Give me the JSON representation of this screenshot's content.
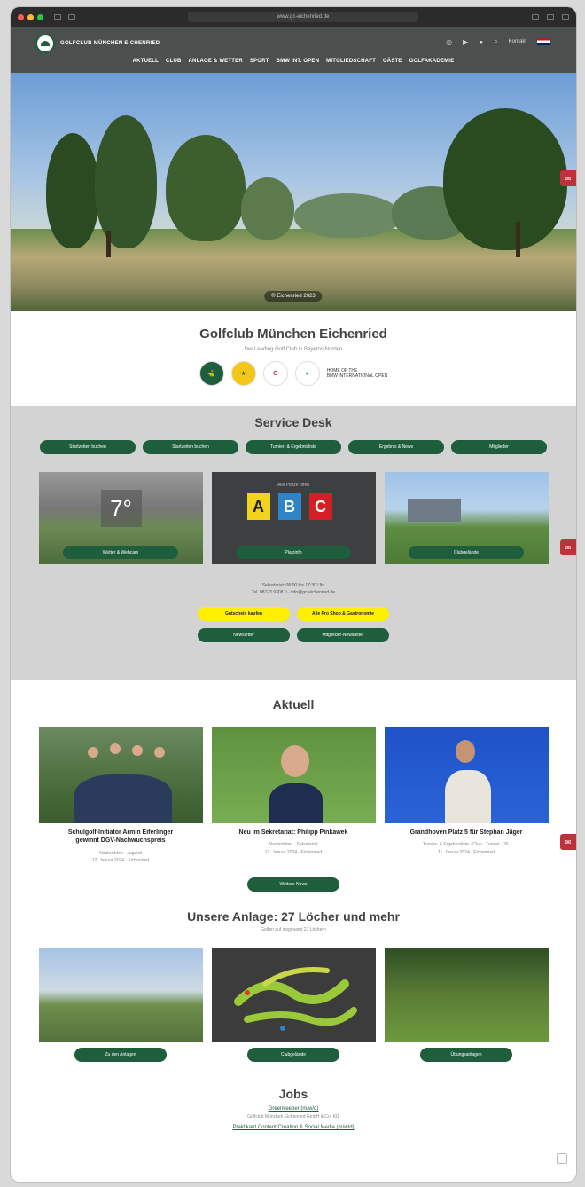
{
  "browser": {
    "url": "www.gc-eichenried.de"
  },
  "header": {
    "logo_text": "GOLFCLUB MÜNCHEN EICHENRIED",
    "kontakt": "Kontakt",
    "nav": [
      "AKTUELL",
      "CLUB",
      "ANLAGE & WETTER",
      "SPORT",
      "BMW INT. OPEN",
      "MITGLIEDSCHAFT",
      "GÄSTE",
      "GOLFAKADEMIE"
    ]
  },
  "hero": {
    "caption": "© Eichenried 2023"
  },
  "intro": {
    "title": "Golfclub München Eichenried",
    "subtitle": "Der Leading Golf Club in Bayerns Norden",
    "partner_icons": [
      "club-crest-icon",
      "leading-golf-clubs-icon",
      "callaway-icon",
      "bmw-icon"
    ],
    "bmw_text_line1": "HOME OF THE",
    "bmw_text_line2": "BMW INTERNATIONAL OPEN"
  },
  "service": {
    "title": "Service Desk",
    "pills": [
      "Startzeiten buchen",
      "Startzeiten buchen",
      "Turnier- & Ergebnisliste",
      "Ergebnis & News",
      "Mitglieder"
    ],
    "cards": {
      "weather": {
        "temp": "7°",
        "button": "Wetter & Webcam"
      },
      "courses": {
        "heading": "Alle Plätze offen",
        "tiles": [
          "A",
          "B",
          "C"
        ],
        "button": "Platzinfo"
      },
      "club": {
        "button": "Clubgelände"
      }
    },
    "hours_line1": "Sekretariat: 08:00 bis 17:30 Uhr",
    "hours_line2": "Tel. 08123 9308 0 · info@gc-eichenried.de",
    "yellow_buttons": [
      "Gutschein kaufen",
      "Alle Pro Shop & Gastronomie"
    ],
    "green_buttons": [
      "Newsletter",
      "Mitglieder-Newsletter"
    ]
  },
  "aktuell": {
    "title": "Aktuell",
    "items": [
      {
        "headline_line1": "Schulgolf-Initiator Armin Eiferlinger",
        "headline_line2": "gewinnt DGV-Nachwuchspreis",
        "meta1": "Nachrichten · Jugend",
        "meta2": "12. Januar 2024 · Eichenried"
      },
      {
        "headline_line1": "Neu im Sekretariat: Philipp Pinkawek",
        "headline_line2": "",
        "meta1": "Nachrichten · Sekretariat",
        "meta2": "12. Januar 2024 · Eichenried"
      },
      {
        "headline_line1": "Grandhoven Platz 5 für Stephan Jäger",
        "headline_line2": "",
        "meta1": "Turnier- & Ergebnisliste · Club · Turnier · 26.",
        "meta2": "11. Januar 2024 · Eichenried"
      }
    ],
    "more_button": "Weitere News"
  },
  "anlage": {
    "title": "Unsere Anlage: 27 Löcher und mehr",
    "subtitle": "Golfen auf insgesamt 27 Löchern",
    "buttons": [
      "Zu den Anlagen",
      "Clubgelände",
      "Übungsanlagen"
    ]
  },
  "jobs": {
    "title": "Jobs",
    "job1": "Greenkeeper (m/w/d)",
    "company": "Golfclub München Eichenried GmbH & Co. KG",
    "job2": "Praktikant Content Creation & Social Media (m/w/d)"
  },
  "colors": {
    "brand_green": "#1f5e3d",
    "header_gray": "#4b4f4e",
    "service_bg": "#d3d3d3",
    "accent_yellow": "#fff000",
    "fab_red": "#c0323b"
  }
}
